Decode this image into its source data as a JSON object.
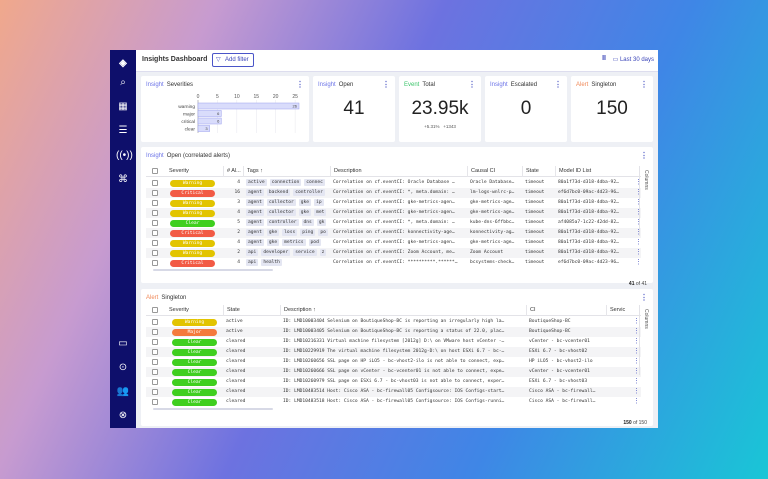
{
  "header": {
    "title": "Insights Dashboard",
    "add_filter": "Add filter",
    "range": "Last 30 days"
  },
  "sidebar": {
    "items": [
      "logo",
      "search",
      "dashboards",
      "list",
      "signals",
      "integrations",
      "chat",
      "settings",
      "users",
      "account"
    ]
  },
  "cards": {
    "severities": {
      "kind": "Insight",
      "title": "Severities"
    },
    "open": {
      "kind": "Insight",
      "title": "Open",
      "value": "41"
    },
    "total": {
      "kind": "Event",
      "title": "Total",
      "value": "23.95k",
      "delta_pct": "+5.31%",
      "delta_abs": "+1343"
    },
    "escalated": {
      "kind": "Insight",
      "title": "Escalated",
      "value": "0"
    },
    "singleton": {
      "kind": "Alert",
      "title": "Singleton",
      "value": "150"
    }
  },
  "chart_data": {
    "type": "bar",
    "orientation": "horizontal",
    "categories": [
      "warning",
      "major",
      "critical",
      "clear"
    ],
    "values": [
      26,
      6,
      6,
      3
    ],
    "xlim": [
      0,
      26
    ],
    "xticks": [
      "0",
      "5",
      "10",
      "15",
      "20",
      "25"
    ],
    "grid": true
  },
  "colors": {
    "Warning": "#e2c400",
    "Critical": "#f25a45",
    "Clear": "#3fcf1f",
    "Major": "#f47a3c",
    "insight": "#6b73e8",
    "event": "#3bc46a",
    "alert": "#f08a5a"
  },
  "table1": {
    "kind": "Insight",
    "title": "Open (correlated alerts)",
    "columns": [
      "Severity",
      "# Al...",
      "Tags ↑",
      "Description",
      "Causal CI",
      "State",
      "Model ID List"
    ],
    "side": "Columns",
    "count": "41",
    "total": "41",
    "of": "of",
    "rows": [
      {
        "sev": "Warning",
        "n": "4",
        "tags": [
          "active",
          "connection",
          "connec"
        ],
        "desc": "Correlation on cf.eventCI: Oracle Database …",
        "ci": "Oracle Database…",
        "state": "timeout",
        "model": "80a1f73d-d318-4dba-92…"
      },
      {
        "sev": "Critical",
        "n": "16",
        "tags": [
          "agent",
          "backend",
          "controller"
        ],
        "desc": "Correlation on cf.eventCI: *, meta.domain: …",
        "ci": "lm-logs-wnlrc-p…",
        "state": "timeout",
        "model": "ef6d7bc0-09ac-4d23-96…"
      },
      {
        "sev": "Warning",
        "n": "3",
        "tags": [
          "agent",
          "collector",
          "gke",
          "ip"
        ],
        "desc": "Correlation on cf.eventCI: gke-metrics-agen…",
        "ci": "gke-metrics-age…",
        "state": "timeout",
        "model": "80a1f73d-d318-4dba-92…"
      },
      {
        "sev": "Warning",
        "n": "4",
        "tags": [
          "agent",
          "collector",
          "gke",
          "met"
        ],
        "desc": "Correlation on cf.eventCI: gke-metrics-agen…",
        "ci": "gke-metrics-age…",
        "state": "timeout",
        "model": "80a1f73d-d318-4dba-92…"
      },
      {
        "sev": "Clear",
        "n": "5",
        "tags": [
          "agent",
          "controller",
          "dns",
          "gk"
        ],
        "desc": "Correlation on cf.eventCI: *, meta.domain: …",
        "ci": "kube-dns-6ffbbc…",
        "state": "timeout",
        "model": "af4085a7-1c22-42dd-82…"
      },
      {
        "sev": "Critical",
        "n": "2",
        "tags": [
          "agent",
          "gke",
          "loss",
          "ping",
          "po"
        ],
        "desc": "Correlation on cf.eventCI: konnectivity-age…",
        "ci": "konnectivity-ag…",
        "state": "timeout",
        "model": "80a1f73d-d318-4dba-92…"
      },
      {
        "sev": "Warning",
        "n": "4",
        "tags": [
          "agent",
          "gke",
          "metrics",
          "pod"
        ],
        "desc": "Correlation on cf.eventCI: gke-metrics-agen…",
        "ci": "gke-metrics-age…",
        "state": "timeout",
        "model": "80a1f73d-d318-4dba-92…"
      },
      {
        "sev": "Warning",
        "n": "2",
        "tags": [
          "api",
          "developer",
          "service",
          "z"
        ],
        "desc": "Correlation on cf.eventCI: Zoom Account, me…",
        "ci": "Zoom Account",
        "state": "timeout",
        "model": "80a1f73d-d318-4dba-92…"
      },
      {
        "sev": "Critical",
        "n": "4",
        "tags": [
          "api",
          "health"
        ],
        "desc": "Correlation on cf.eventCI: **********.******…",
        "ci": "bcsystems-check…",
        "state": "timeout",
        "model": "ef6d7bc0-09ac-4d23-96…"
      }
    ]
  },
  "table2": {
    "kind": "Alert",
    "title": "Singleton",
    "columns": [
      "Severity",
      "State",
      "Description ↑",
      "CI",
      "Servic"
    ],
    "side": "Columns",
    "count": "150",
    "total": "150",
    "of": "of",
    "rows": [
      {
        "sev": "Warning",
        "state": "active",
        "desc": "ID: LMD10003404 Selenium on BoutiqueShop-BC is reporting an irregularly high la…",
        "ci": "BoutiqueShop-BC"
      },
      {
        "sev": "Major",
        "state": "active",
        "desc": "ID: LMD10003405 Selenium on BoutiqueShop-BC is reporting a status of 22.0, plac…",
        "ci": "BoutiqueShop-BC"
      },
      {
        "sev": "Clear",
        "state": "cleared",
        "desc": "ID: LMD10216331 Virtual machine filesystem [2012g] D:\\ on VMware host vCenter -…",
        "ci": "vCenter - bc-vcenter01"
      },
      {
        "sev": "Clear",
        "state": "cleared",
        "desc": "ID: LMD10229919 The virtual machine filesystem 2012g-D:\\ on host ESXi 6.7 - bc-…",
        "ci": "ESXi 6.7 - bc-vhost02"
      },
      {
        "sev": "Clear",
        "state": "cleared",
        "desc": "ID: LMD10260656 SSL page on HP iLO5 - bc-vhost2-ilo is not able to connect, exp…",
        "ci": "HP iLO5 - bc-vhost2-ilo"
      },
      {
        "sev": "Clear",
        "state": "cleared",
        "desc": "ID: LMD10260666 SSL page on vCenter - bc-vcenter01 is not able to connect, expe…",
        "ci": "vCenter - bc-vcenter01"
      },
      {
        "sev": "Clear",
        "state": "cleared",
        "desc": "ID: LMD10260979 SSL page on ESXi 6.7 - bc-vhost03 is not able to connect, exper…",
        "ci": "ESXi 6.7 - bc-vhost03"
      },
      {
        "sev": "Clear",
        "state": "cleared",
        "desc": "ID: LMD10483514 Host: Cisco ASA - bc-firewall05 Configsource: IOS Configs-start…",
        "ci": "Cisco ASA - bc-firewall…"
      },
      {
        "sev": "Clear",
        "state": "cleared",
        "desc": "ID: LMD10483518 Host: Cisco ASA - bc-firewall05 Configsource: IOS Configs-runni…",
        "ci": "Cisco ASA - bc-firewall…"
      }
    ]
  }
}
